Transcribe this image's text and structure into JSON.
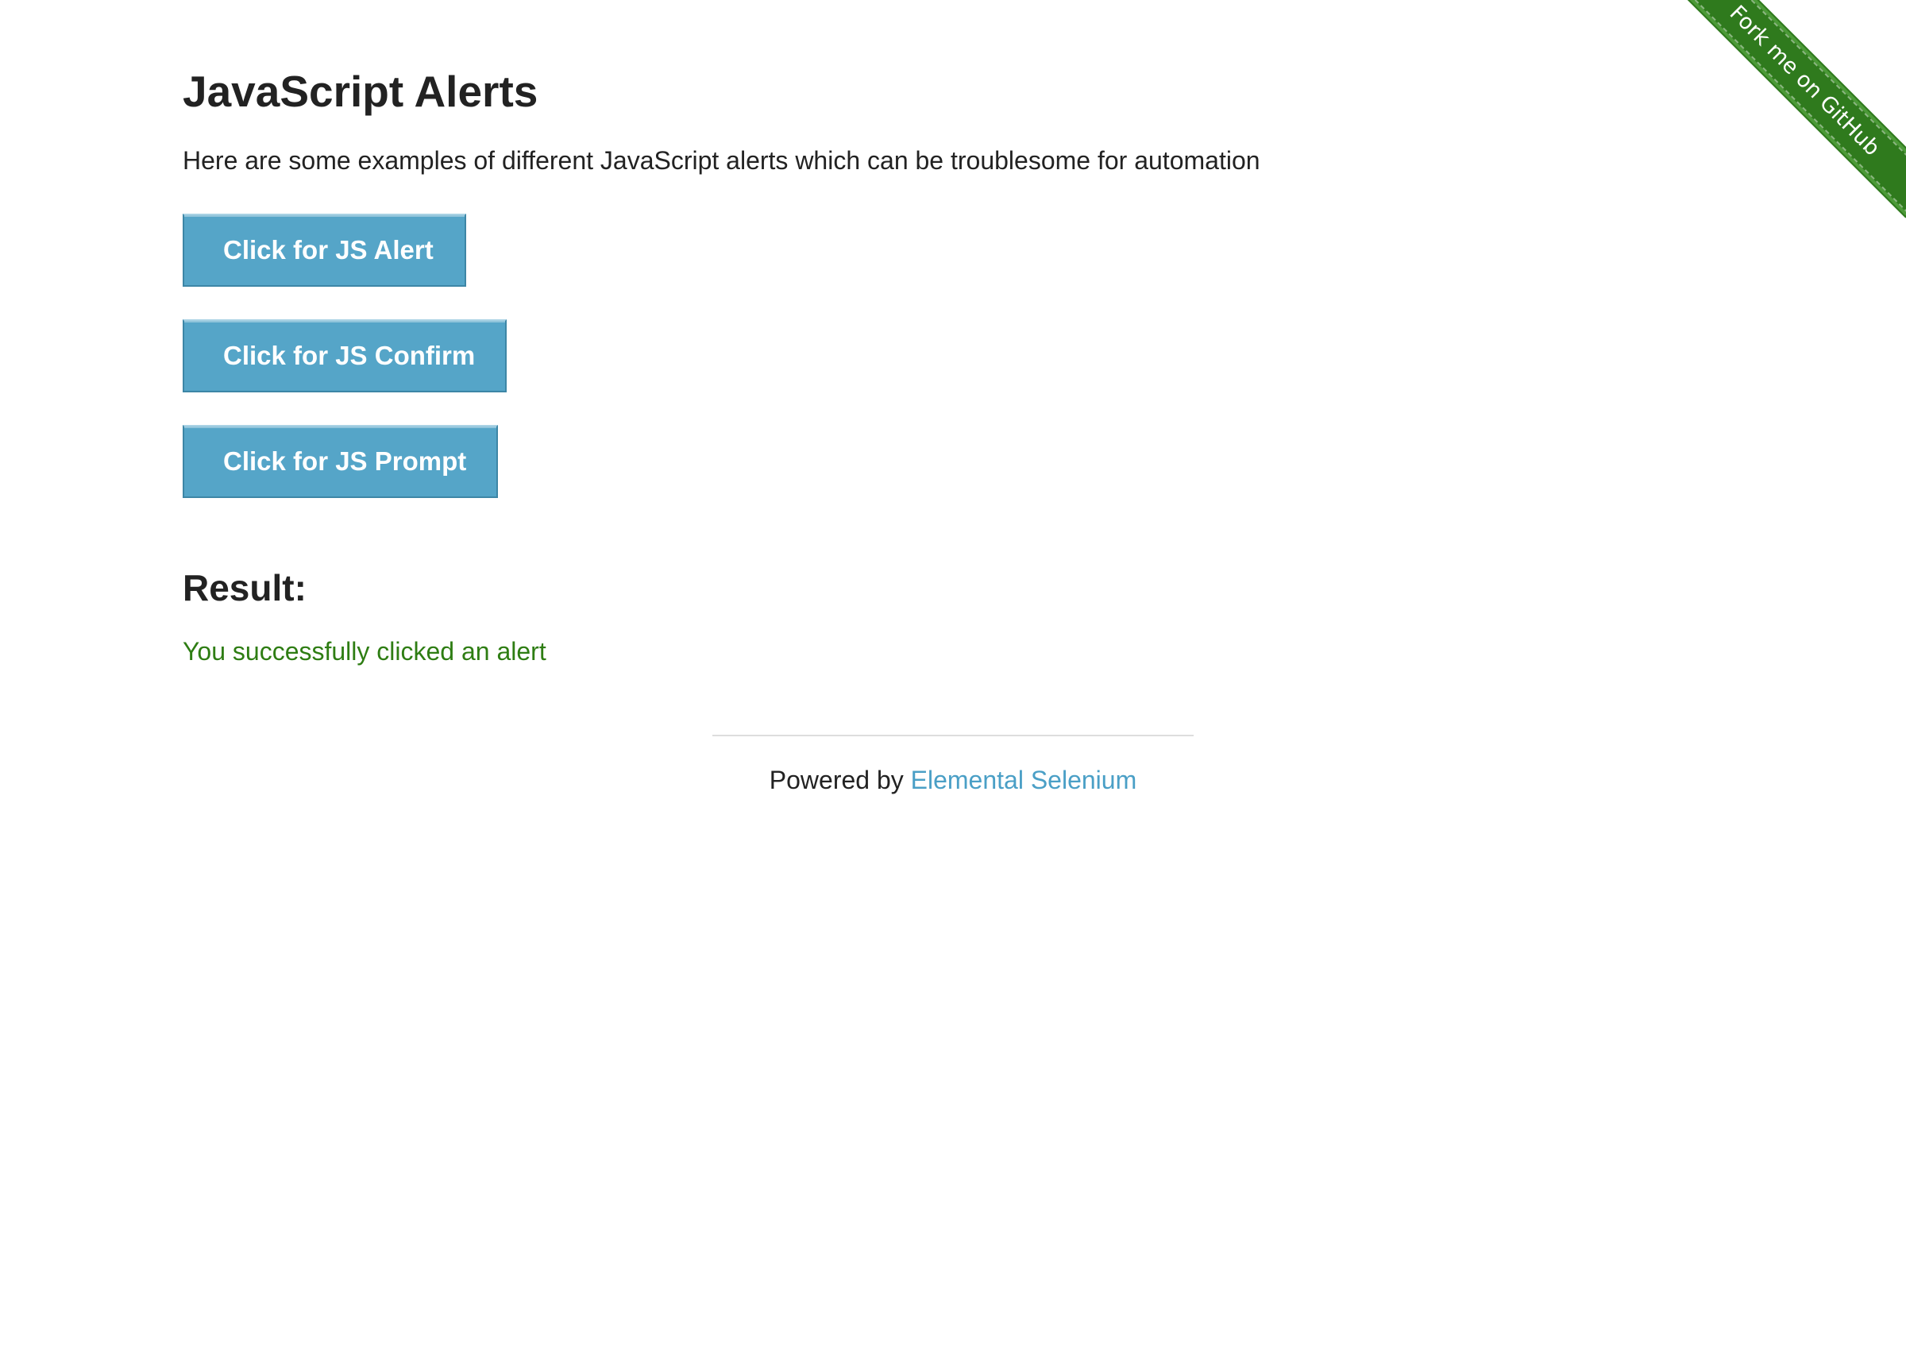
{
  "page": {
    "title": "JavaScript Alerts",
    "intro": "Here are some examples of different JavaScript alerts which can be troublesome for automation"
  },
  "buttons": {
    "alert_label": "Click for JS Alert",
    "confirm_label": "Click for JS Confirm",
    "prompt_label": "Click for JS Prompt"
  },
  "result": {
    "heading": "Result:",
    "text": "You successfully clicked an alert"
  },
  "footer": {
    "prefix": "Powered by ",
    "link_text": "Elemental Selenium"
  },
  "ribbon": {
    "text": "Fork me on GitHub"
  },
  "colors": {
    "button_bg": "#55a5c8",
    "result_text": "#2e7d13",
    "link": "#4a9fc6",
    "ribbon": "#2f7a1d"
  }
}
